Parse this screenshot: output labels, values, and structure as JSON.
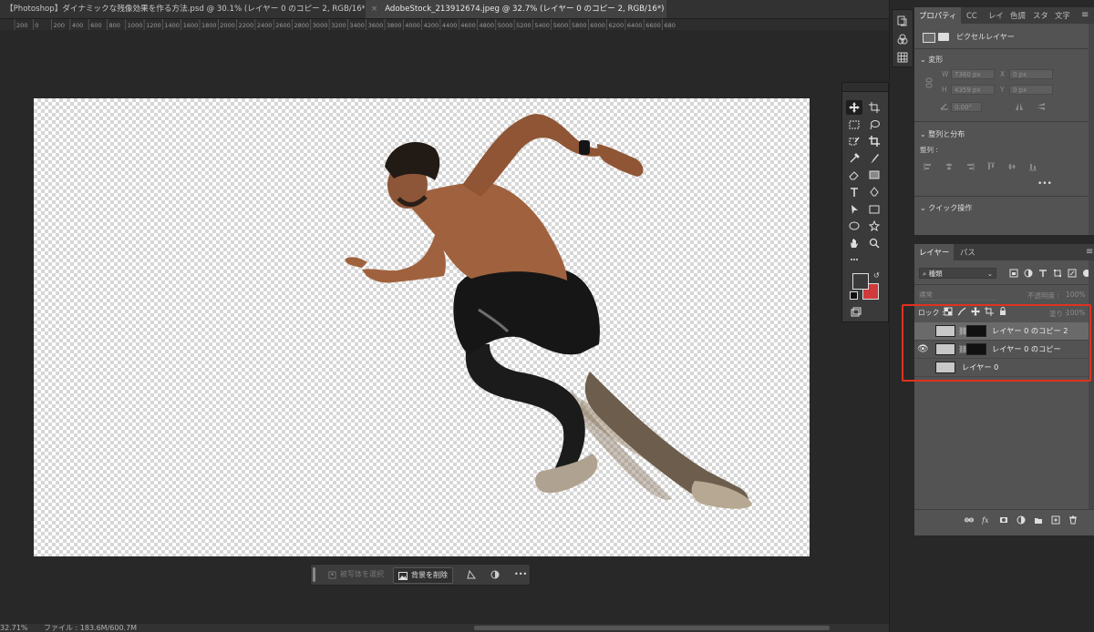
{
  "tabs": [
    {
      "label": "【Photoshop】ダイナミックな残像効果を作る方法.psd @ 30.1% (レイヤー 0 のコピー 2, RGB/16*)",
      "active": false
    },
    {
      "label": "AdobeStock_213912674.jpeg @ 32.7% (レイヤー 0 のコピー 2, RGB/16*) *",
      "active": true
    }
  ],
  "ruler": {
    "ticks": [
      "200",
      "0",
      "200",
      "400",
      "600",
      "800",
      "1000",
      "1200",
      "1400",
      "1600",
      "1800",
      "2000",
      "2200",
      "2400",
      "2600",
      "2800",
      "3000",
      "3200",
      "3400",
      "3600",
      "3800",
      "4000",
      "4200",
      "4400",
      "4600",
      "4800",
      "5000",
      "5200",
      "5400",
      "5600",
      "5800",
      "6000",
      "6200",
      "6400",
      "6600",
      "680"
    ]
  },
  "contextual_bar": {
    "select_subject": "被写体を選択",
    "remove_background": "背景を削除",
    "more": "•••"
  },
  "status": {
    "zoom": "32.71%",
    "file": "ファイル : 183.6M/600.7M"
  },
  "properties": {
    "tabs": [
      "プロパティ",
      "CC",
      "レイ",
      "色調",
      "スタ",
      "文字"
    ],
    "layer_type": "ピクセルレイヤー",
    "transform_title": "変形",
    "w_label": "W",
    "w_value": "7360 px",
    "x_label": "X",
    "x_value": "0 px",
    "h_label": "H",
    "h_value": "4359 px",
    "y_label": "Y",
    "y_value": "0 px",
    "angle_value": "0.00°",
    "align_title": "整列と分布",
    "align_label": "整列 :",
    "more": "•••",
    "quick_title": "クイック操作"
  },
  "layers_panel": {
    "tabs": [
      "レイヤー",
      "パス"
    ],
    "filter_kind": "種類",
    "blend_mode": "通常",
    "opacity_label": "不透明度 :",
    "opacity_value": "100%",
    "lock_label": "ロック :",
    "fill_label": "塗り :",
    "fill_value": "100%",
    "layers": [
      {
        "name": "レイヤー 0 のコピー 2",
        "visible": false,
        "selected": true,
        "has_mask": true
      },
      {
        "name": "レイヤー 0 のコピー",
        "visible": true,
        "selected": false,
        "has_mask": true
      },
      {
        "name": "レイヤー 0",
        "visible": false,
        "selected": false,
        "has_mask": false
      }
    ]
  },
  "colors": {
    "highlight_box": "#e0321e",
    "foreground": "#3a3a3a",
    "background": "#d03a3a"
  }
}
